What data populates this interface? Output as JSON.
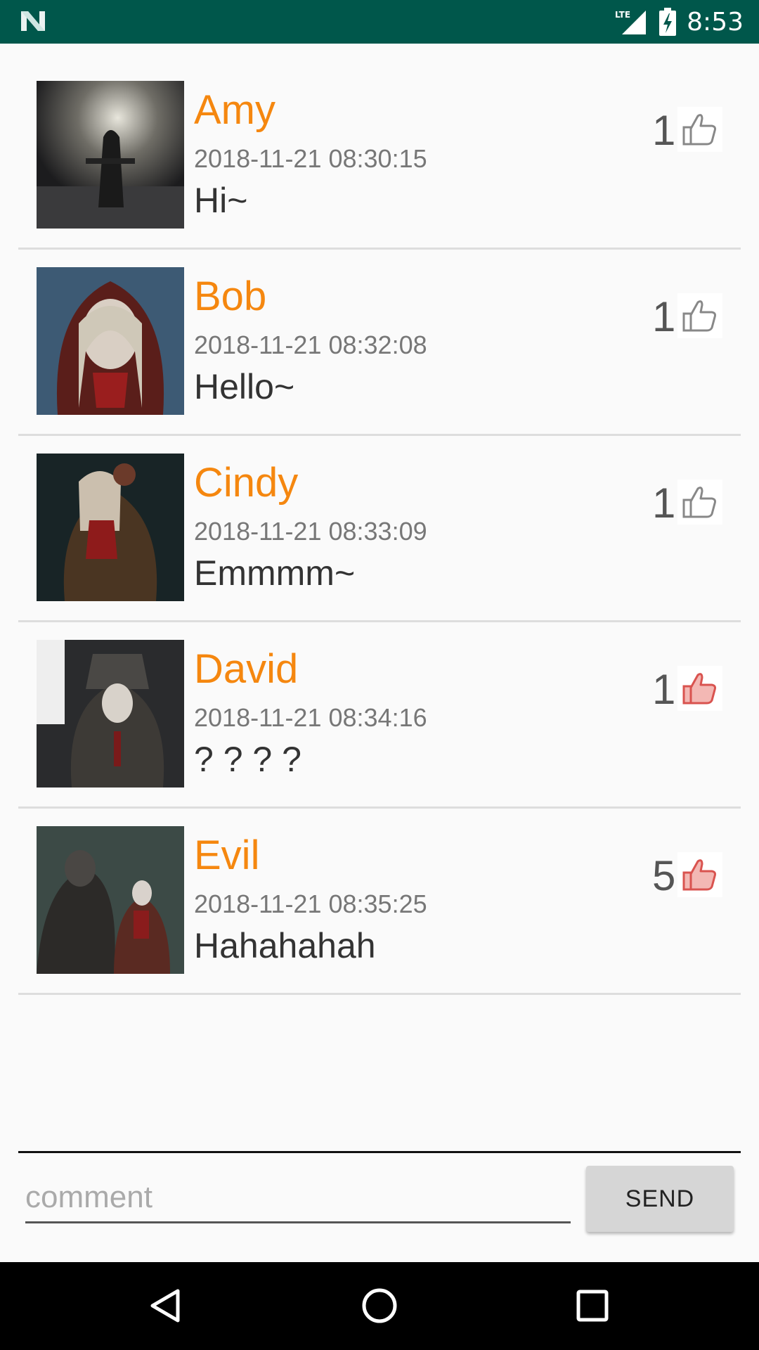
{
  "status_bar": {
    "time": "8:53",
    "network": "LTE",
    "background_color": "#00574b"
  },
  "comments": [
    {
      "name": "Amy",
      "time": "2018-11-21 08:30:15",
      "text": "Hi~",
      "likes": "1",
      "liked": false,
      "avatar": "avatar-image"
    },
    {
      "name": "Bob",
      "time": "2018-11-21 08:32:08",
      "text": "Hello~",
      "likes": "1",
      "liked": false,
      "avatar": "avatar-image"
    },
    {
      "name": "Cindy",
      "time": "2018-11-21 08:33:09",
      "text": "Emmmm~",
      "likes": "1",
      "liked": false,
      "avatar": "avatar-image"
    },
    {
      "name": "David",
      "time": "2018-11-21 08:34:16",
      "text": "? ? ? ?",
      "likes": "1",
      "liked": true,
      "avatar": "avatar-image"
    },
    {
      "name": "Evil",
      "time": "2018-11-21 08:35:25",
      "text": "Hahahahah",
      "likes": "5",
      "liked": true,
      "avatar": "avatar-image"
    }
  ],
  "input": {
    "placeholder": "comment",
    "value": ""
  },
  "send_button": {
    "label": "SEND"
  },
  "colors": {
    "name": "#f5870f",
    "like_inactive": "#888888",
    "like_active": "#d9534f"
  },
  "nav_bar": {
    "back_icon": "back-icon",
    "home_icon": "home-icon",
    "recents_icon": "recents-icon"
  }
}
